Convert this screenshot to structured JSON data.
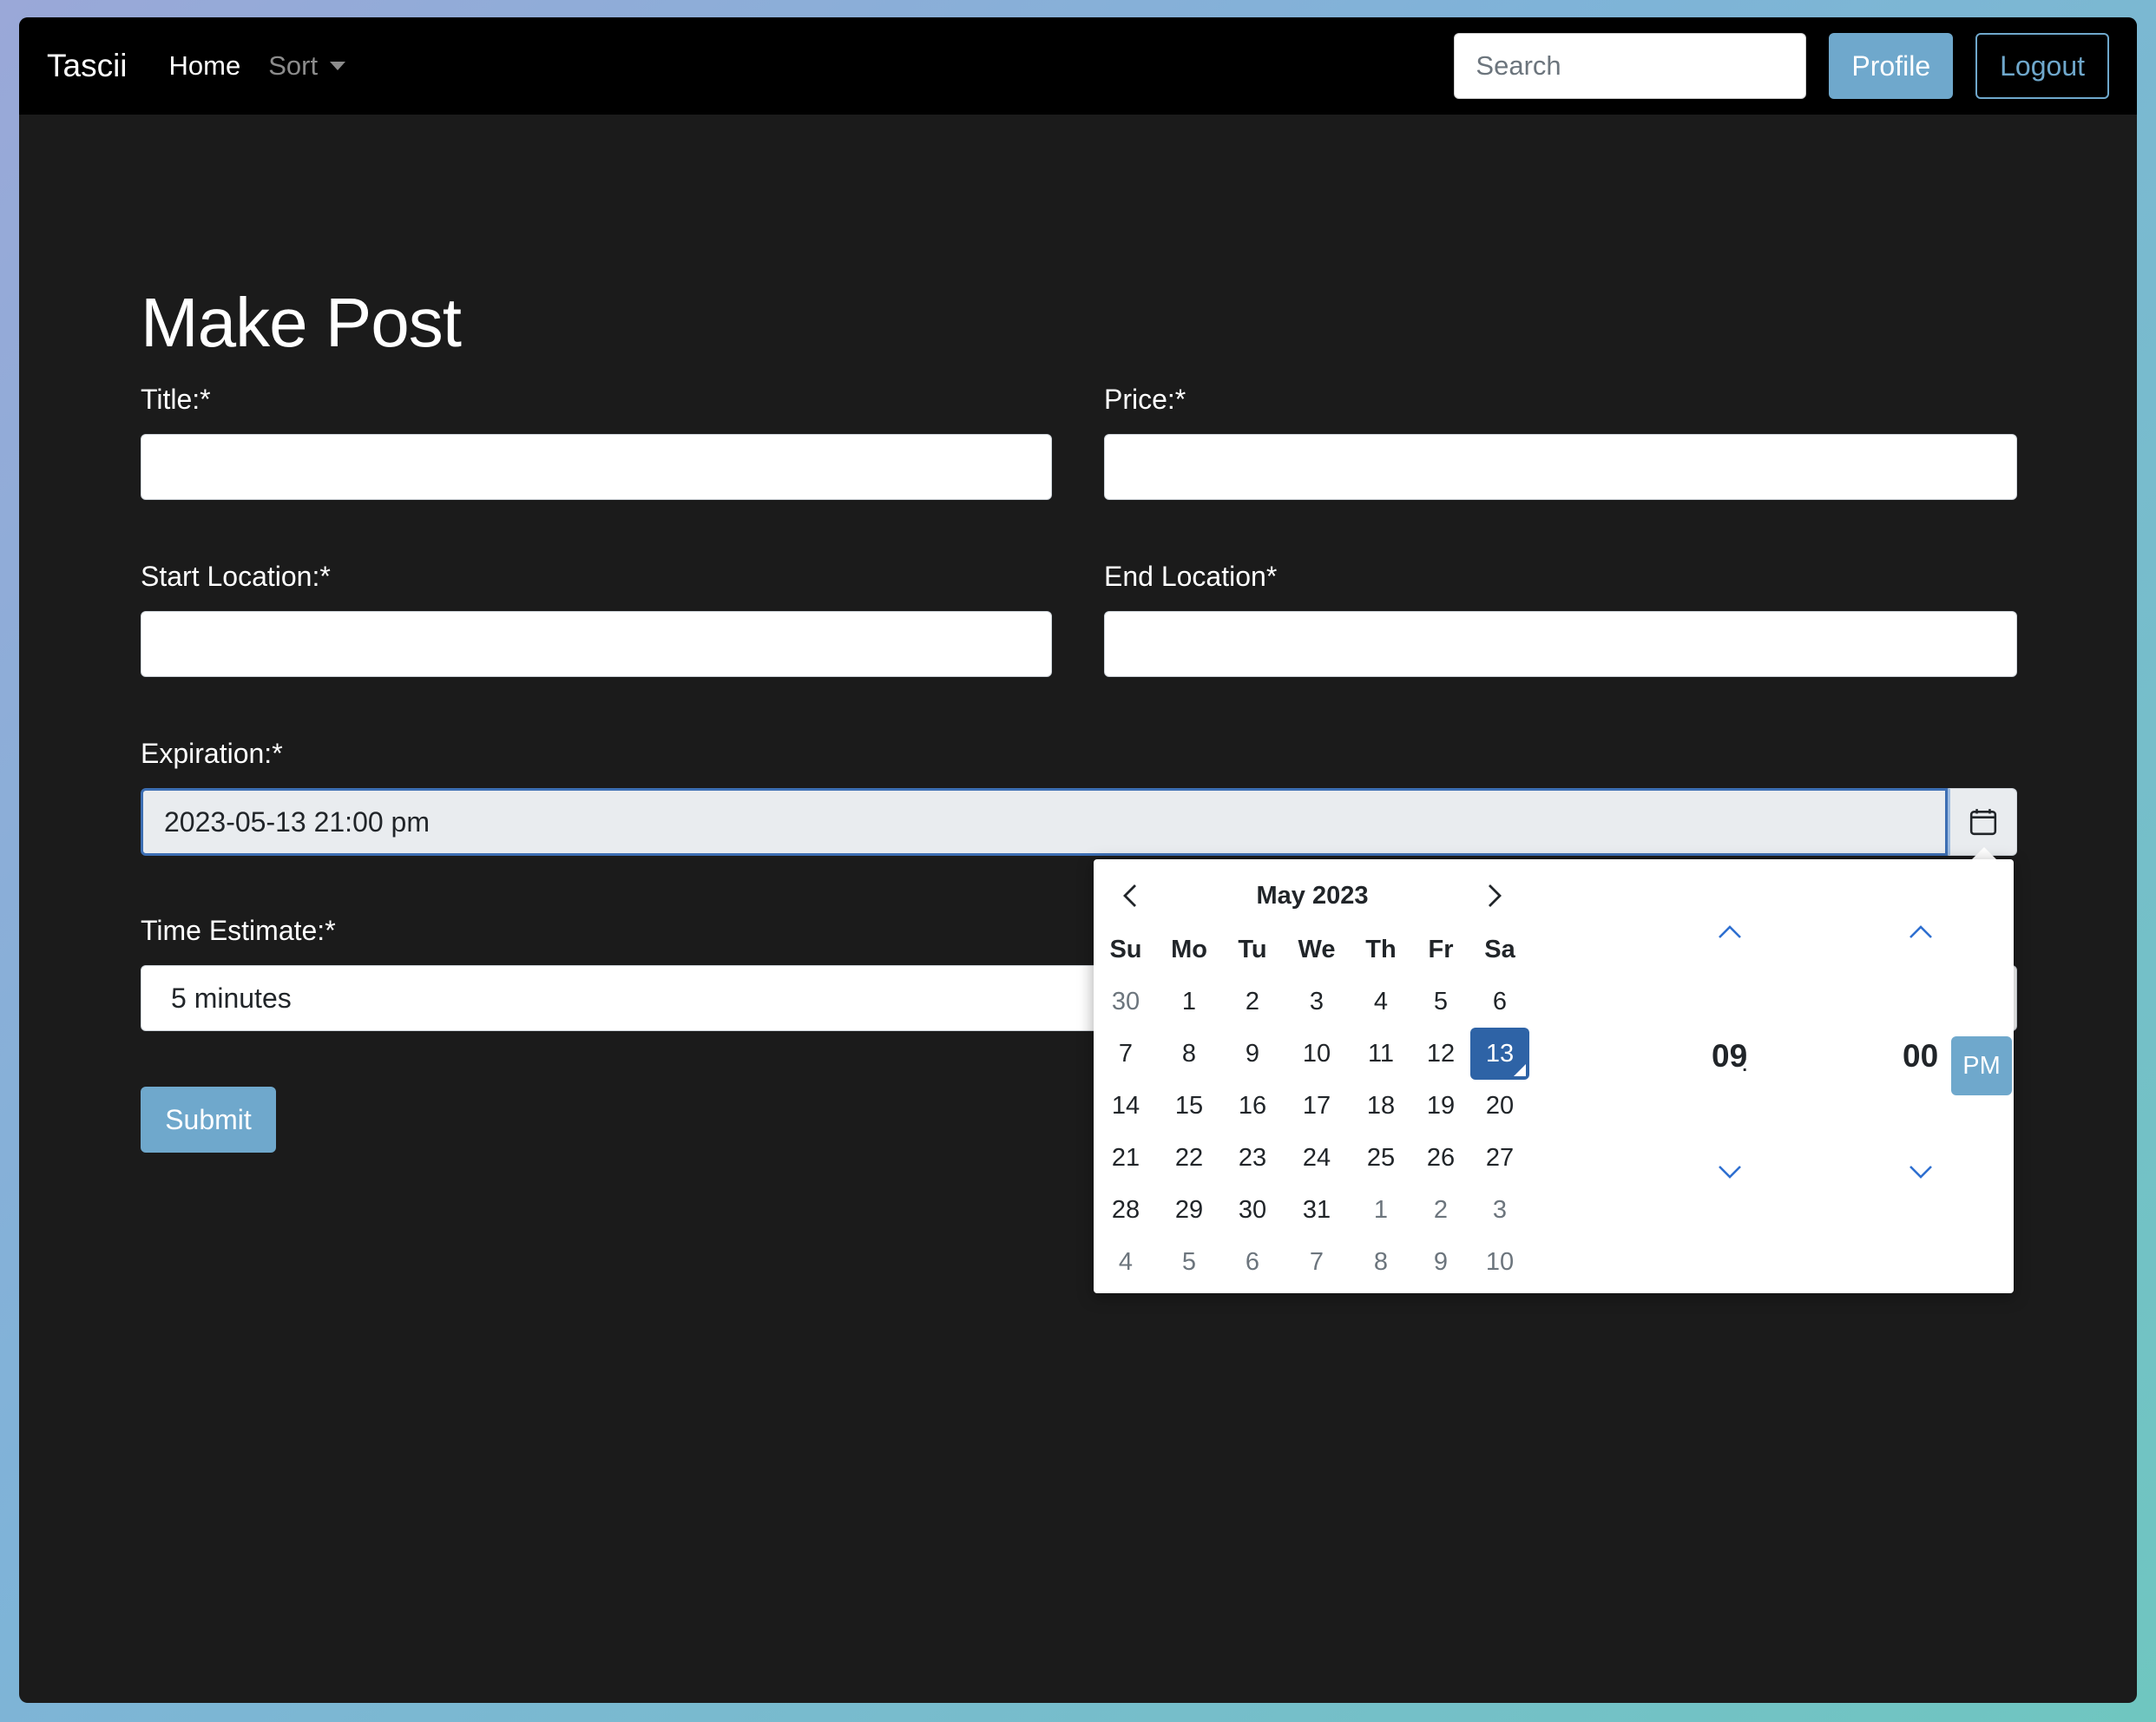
{
  "navbar": {
    "brand": "Tascii",
    "home": "Home",
    "sort": "Sort",
    "search_placeholder": "Search",
    "profile": "Profile",
    "logout": "Logout"
  },
  "form": {
    "heading": "Make Post",
    "title_label": "Title:*",
    "price_label": "Price:*",
    "start_location_label": "Start Location:*",
    "end_location_label": "End Location*",
    "expiration_label": "Expiration:*",
    "expiration_value": "2023-05-13 21:00 pm",
    "time_estimate_label": "Time Estimate:*",
    "time_estimate_value": "5 minutes",
    "submit": "Submit"
  },
  "picker": {
    "month_title": "May 2023",
    "weekdays": [
      "Su",
      "Mo",
      "Tu",
      "We",
      "Th",
      "Fr",
      "Sa"
    ],
    "weeks": [
      [
        {
          "d": "30",
          "m": true
        },
        {
          "d": "1"
        },
        {
          "d": "2"
        },
        {
          "d": "3"
        },
        {
          "d": "4"
        },
        {
          "d": "5"
        },
        {
          "d": "6"
        }
      ],
      [
        {
          "d": "7"
        },
        {
          "d": "8"
        },
        {
          "d": "9"
        },
        {
          "d": "10"
        },
        {
          "d": "11"
        },
        {
          "d": "12"
        },
        {
          "d": "13",
          "s": true
        }
      ],
      [
        {
          "d": "14"
        },
        {
          "d": "15"
        },
        {
          "d": "16"
        },
        {
          "d": "17"
        },
        {
          "d": "18"
        },
        {
          "d": "19"
        },
        {
          "d": "20"
        }
      ],
      [
        {
          "d": "21"
        },
        {
          "d": "22"
        },
        {
          "d": "23"
        },
        {
          "d": "24"
        },
        {
          "d": "25"
        },
        {
          "d": "26"
        },
        {
          "d": "27"
        }
      ],
      [
        {
          "d": "28"
        },
        {
          "d": "29"
        },
        {
          "d": "30"
        },
        {
          "d": "31"
        },
        {
          "d": "1",
          "m": true
        },
        {
          "d": "2",
          "m": true
        },
        {
          "d": "3",
          "m": true
        }
      ],
      [
        {
          "d": "4",
          "m": true
        },
        {
          "d": "5",
          "m": true
        },
        {
          "d": "6",
          "m": true
        },
        {
          "d": "7",
          "m": true
        },
        {
          "d": "8",
          "m": true
        },
        {
          "d": "9",
          "m": true
        },
        {
          "d": "10",
          "m": true
        }
      ]
    ],
    "hour": "09",
    "colon": ":",
    "minute": "00",
    "ampm": "PM"
  },
  "colors": {
    "accent": "#6fa8cc",
    "selected_day": "#2e63a6",
    "page_bg": "#1b1b1b",
    "navbar_bg": "#000000"
  }
}
